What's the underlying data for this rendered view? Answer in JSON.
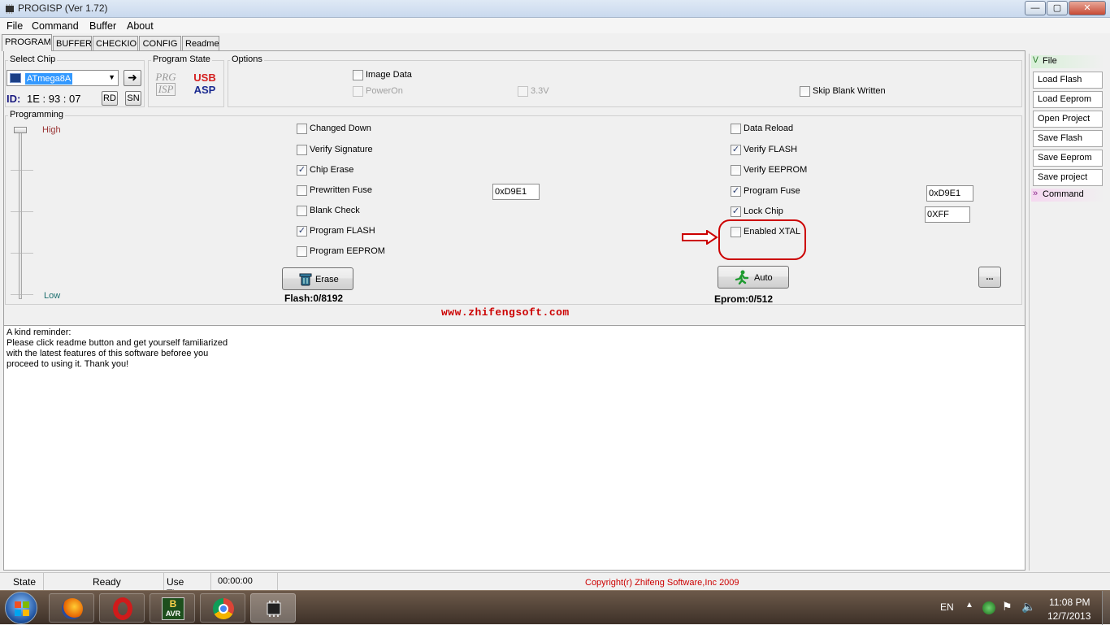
{
  "window": {
    "title": "PROGISP (Ver 1.72)",
    "min": "—",
    "max": "▢",
    "close": "✕"
  },
  "menu": [
    "File",
    "Command",
    "Buffer",
    "About"
  ],
  "tabs": [
    "PROGRAM",
    "BUFFER",
    "CHECKIO",
    "CONFIG",
    "Readme"
  ],
  "select_chip": {
    "label": "Select Chip",
    "chip": "ATmega8A",
    "id_label": "ID:",
    "id_value": "1E : 93 : 07",
    "rd": "RD",
    "sn": "SN"
  },
  "program_state": {
    "label": "Program State",
    "prg_line1": "PRG",
    "prg_line2": "ISP",
    "usb_line1": "USB",
    "usb_line2": "ASP"
  },
  "options": {
    "label": "Options",
    "image_data": {
      "label": "Image Data",
      "checked": false
    },
    "power_on": {
      "label": "PowerOn",
      "checked": false
    },
    "v33": {
      "label": "3.3V",
      "checked": false
    },
    "skip_blank": {
      "label": "Skip Blank Written",
      "checked": false
    }
  },
  "programming": {
    "label": "Programming",
    "high": "High",
    "low": "Low",
    "left_items": [
      {
        "label": "Changed Down",
        "checked": false
      },
      {
        "label": "Verify Signature",
        "checked": false
      },
      {
        "label": "Chip Erase",
        "checked": true
      },
      {
        "label": "Prewritten Fuse",
        "checked": false
      },
      {
        "label": "Blank Check",
        "checked": false
      },
      {
        "label": "Program FLASH",
        "checked": true
      },
      {
        "label": "Program EEPROM",
        "checked": false
      }
    ],
    "right_items": [
      {
        "label": "Data Reload",
        "checked": false
      },
      {
        "label": "Verify FLASH",
        "checked": true
      },
      {
        "label": "Verify EEPROM",
        "checked": false
      },
      {
        "label": "Program Fuse",
        "checked": true
      },
      {
        "label": "Lock Chip",
        "checked": true
      },
      {
        "label": "Enabled XTAL",
        "checked": false
      }
    ],
    "prewritten_fuse_value": "0xD9E1",
    "program_fuse_value": "0xD9E1",
    "lock_chip_value": "0XFF",
    "erase_button": "Erase",
    "auto_button": "Auto",
    "more_button": "...",
    "flash_info": "Flash:0/8192",
    "eprom_info": "Eprom:0/512"
  },
  "website": "www.zhifengsoft.com",
  "log_text": "A kind reminder:\nPlease click readme button and get yourself familiarized\nwith the latest features of this software beforee you\nproceed to using it. Thank you!",
  "side_panel": {
    "file_header": "File",
    "buttons": [
      "Load Flash",
      "Load Eeprom",
      "Open Project",
      "Save Flash",
      "Save Eeprom",
      "Save project"
    ],
    "command_header": "Command"
  },
  "status": {
    "state_label": "State",
    "state_value": "Ready",
    "use_times_label": "Use Times",
    "use_times_value": "00:00:00",
    "copyright": "Copyright(r) Zhifeng Software,Inc 2009"
  },
  "taskbar": {
    "lang": "EN",
    "time": "11:08 PM",
    "date": "12/7/2013",
    "avr_label": "AVR",
    "avr_top": "B"
  },
  "colors": {
    "accent_red": "#cc0000",
    "selection": "#3399ff",
    "high_label": "#993333",
    "low_label": "#1a6e6e"
  }
}
